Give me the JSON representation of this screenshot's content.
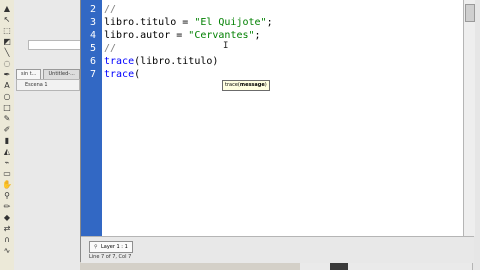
{
  "tools": [
    {
      "icon": "arrow-icon",
      "glyph": "▲"
    },
    {
      "icon": "subselect-icon",
      "glyph": "↖"
    },
    {
      "icon": "free-transform-icon",
      "glyph": "⬚"
    },
    {
      "icon": "gradient-icon",
      "glyph": "◩"
    },
    {
      "icon": "line-icon",
      "glyph": "╲"
    },
    {
      "icon": "lasso-icon",
      "glyph": "◌"
    },
    {
      "icon": "pen-icon",
      "glyph": "✒"
    },
    {
      "icon": "text-icon",
      "glyph": "A"
    },
    {
      "icon": "oval-icon",
      "glyph": "○"
    },
    {
      "icon": "rectangle-icon",
      "glyph": "□"
    },
    {
      "icon": "pencil-icon",
      "glyph": "✎"
    },
    {
      "icon": "brush-icon",
      "glyph": "✐"
    },
    {
      "icon": "ink-bottle-icon",
      "glyph": "▮"
    },
    {
      "icon": "paint-bucket-icon",
      "glyph": "◭"
    },
    {
      "icon": "eyedropper-icon",
      "glyph": "⌁"
    },
    {
      "icon": "eraser-icon",
      "glyph": "▭"
    },
    {
      "icon": "hand-icon",
      "glyph": "✋"
    },
    {
      "icon": "zoom-icon",
      "glyph": "⚲"
    },
    {
      "icon": "stroke-color-icon",
      "glyph": "✏"
    },
    {
      "icon": "fill-color-icon",
      "glyph": "◆"
    },
    {
      "icon": "swap-colors-icon",
      "glyph": "⇄"
    },
    {
      "icon": "snap-icon",
      "glyph": "∩"
    },
    {
      "icon": "smooth-icon",
      "glyph": "∿"
    }
  ],
  "background_panel": {
    "tabs": [
      "sin t...",
      "Untitled-..."
    ],
    "scene_label": "Escena 1"
  },
  "editor": {
    "lines": [
      {
        "num": "2",
        "tokens": [
          {
            "t": "//",
            "c": "cmt"
          }
        ]
      },
      {
        "num": "3",
        "tokens": [
          {
            "t": "libro.titulo = ",
            "c": "plain"
          },
          {
            "t": "\"El Quijote\"",
            "c": "str"
          },
          {
            "t": ";",
            "c": "plain"
          }
        ]
      },
      {
        "num": "4",
        "tokens": [
          {
            "t": "libro.autor = ",
            "c": "plain"
          },
          {
            "t": "\"Cervantes\"",
            "c": "str"
          },
          {
            "t": ";",
            "c": "plain"
          }
        ]
      },
      {
        "num": "5",
        "tokens": [
          {
            "t": "//",
            "c": "cmt"
          }
        ]
      },
      {
        "num": "6",
        "tokens": [
          {
            "t": "trace",
            "c": "kw"
          },
          {
            "t": "(libro.titulo)",
            "c": "plain"
          }
        ]
      },
      {
        "num": "7",
        "tokens": [
          {
            "t": "trace",
            "c": "kw"
          },
          {
            "t": "(",
            "c": "plain"
          }
        ]
      }
    ],
    "code_hint": {
      "prefix": "trace(",
      "param": "message",
      "suffix": ")"
    },
    "ibeam": "I"
  },
  "script_tab": {
    "label": "Layer 1 : 1",
    "icon": "pin-icon"
  },
  "status": "Line 7 of 7, Col 7",
  "colors": {
    "gutter": "#3268c4",
    "keyword": "#0000ff",
    "string": "#008000",
    "comment": "#808080"
  }
}
